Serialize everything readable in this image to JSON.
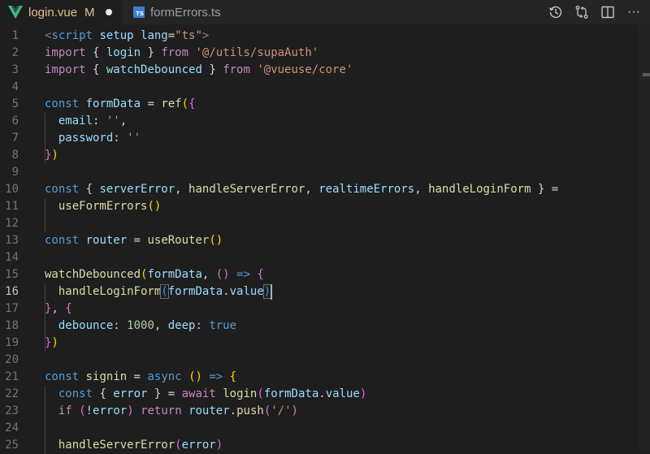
{
  "tabs": [
    {
      "label": "login.vue",
      "modified": "M",
      "icon": "vue-icon",
      "active": true
    },
    {
      "label": "formErrors.ts",
      "icon": "typescript-icon",
      "ts_badge": "TS",
      "active": false
    }
  ],
  "actions": [
    {
      "name": "timeline-icon"
    },
    {
      "name": "source-control-compare-icon"
    },
    {
      "name": "split-editor-icon"
    },
    {
      "name": "more-actions-icon",
      "glyph": "···"
    }
  ],
  "current_line": 16,
  "lines": [
    {
      "n": "1",
      "tokens": [
        [
          "tag",
          "<"
        ],
        [
          "kw",
          "script"
        ],
        [
          "var",
          " setup"
        ],
        [
          "var",
          " lang"
        ],
        [
          "pu",
          "="
        ],
        [
          "str",
          "\"ts\""
        ],
        [
          "tag",
          ">"
        ]
      ]
    },
    {
      "n": "2",
      "tokens": [
        [
          "ctl",
          "import"
        ],
        [
          "pu",
          " { "
        ],
        [
          "var",
          "login"
        ],
        [
          "pu",
          " } "
        ],
        [
          "ctl",
          "from"
        ],
        [
          "pu",
          " "
        ],
        [
          "str",
          "'@/utils/supaAuth'"
        ]
      ]
    },
    {
      "n": "3",
      "tokens": [
        [
          "ctl",
          "import"
        ],
        [
          "pu",
          " { "
        ],
        [
          "var",
          "watchDebounced"
        ],
        [
          "pu",
          " } "
        ],
        [
          "ctl",
          "from"
        ],
        [
          "pu",
          " "
        ],
        [
          "str",
          "'@vueuse/core'"
        ]
      ]
    },
    {
      "n": "4",
      "tokens": []
    },
    {
      "n": "5",
      "tokens": [
        [
          "kw",
          "const"
        ],
        [
          "pu",
          " "
        ],
        [
          "var",
          "formData"
        ],
        [
          "pu",
          " = "
        ],
        [
          "fn",
          "ref"
        ],
        [
          "br1",
          "("
        ],
        [
          "br2",
          "{"
        ]
      ]
    },
    {
      "n": "6",
      "tokens": [
        [
          "pu",
          "  "
        ],
        [
          "var",
          "email"
        ],
        [
          "pu",
          ": "
        ],
        [
          "str",
          "''"
        ],
        [
          "pu",
          ","
        ]
      ]
    },
    {
      "n": "7",
      "tokens": [
        [
          "pu",
          "  "
        ],
        [
          "var",
          "password"
        ],
        [
          "pu",
          ": "
        ],
        [
          "str",
          "''"
        ]
      ]
    },
    {
      "n": "8",
      "tokens": [
        [
          "br2",
          "}"
        ],
        [
          "br1",
          ")"
        ]
      ]
    },
    {
      "n": "9",
      "tokens": []
    },
    {
      "n": "10",
      "tokens": [
        [
          "kw",
          "const"
        ],
        [
          "pu",
          " { "
        ],
        [
          "var",
          "serverError"
        ],
        [
          "pu",
          ", "
        ],
        [
          "fn",
          "handleServerError"
        ],
        [
          "pu",
          ", "
        ],
        [
          "var",
          "realtimeErrors"
        ],
        [
          "pu",
          ", "
        ],
        [
          "fn",
          "handleLoginForm"
        ],
        [
          "pu",
          " } ="
        ]
      ]
    },
    {
      "n": "11",
      "tokens": [
        [
          "pu",
          "  "
        ],
        [
          "fn",
          "useFormErrors"
        ],
        [
          "br1",
          "()"
        ]
      ]
    },
    {
      "n": "12",
      "tokens": []
    },
    {
      "n": "13",
      "tokens": [
        [
          "kw",
          "const"
        ],
        [
          "pu",
          " "
        ],
        [
          "var",
          "router"
        ],
        [
          "pu",
          " = "
        ],
        [
          "fn",
          "useRouter"
        ],
        [
          "br1",
          "()"
        ]
      ]
    },
    {
      "n": "14",
      "tokens": []
    },
    {
      "n": "15",
      "tokens": [
        [
          "fn",
          "watchDebounced"
        ],
        [
          "br1",
          "("
        ],
        [
          "var",
          "formData"
        ],
        [
          "pu",
          ", "
        ],
        [
          "br2",
          "()"
        ],
        [
          "pu",
          " "
        ],
        [
          "kw",
          "=>"
        ],
        [
          "pu",
          " "
        ],
        [
          "br2",
          "{"
        ]
      ]
    },
    {
      "n": "16",
      "tokens": [
        [
          "pu",
          "  "
        ],
        [
          "fn",
          "handleLoginForm"
        ],
        [
          "hl",
          "("
        ],
        [
          "var",
          "formData"
        ],
        [
          "pu",
          "."
        ],
        [
          "var",
          "value"
        ],
        [
          "hl",
          ")"
        ]
      ]
    },
    {
      "n": "17",
      "tokens": [
        [
          "br2",
          "}"
        ],
        [
          "pu",
          ", "
        ],
        [
          "br2",
          "{"
        ]
      ]
    },
    {
      "n": "18",
      "tokens": [
        [
          "pu",
          "  "
        ],
        [
          "var",
          "debounce"
        ],
        [
          "pu",
          ": "
        ],
        [
          "num",
          "1000"
        ],
        [
          "pu",
          ", "
        ],
        [
          "var",
          "deep"
        ],
        [
          "pu",
          ": "
        ],
        [
          "kw",
          "true"
        ]
      ]
    },
    {
      "n": "19",
      "tokens": [
        [
          "br2",
          "}"
        ],
        [
          "br1",
          ")"
        ]
      ]
    },
    {
      "n": "20",
      "tokens": []
    },
    {
      "n": "21",
      "tokens": [
        [
          "kw",
          "const"
        ],
        [
          "pu",
          " "
        ],
        [
          "fn",
          "signin"
        ],
        [
          "pu",
          " = "
        ],
        [
          "kw",
          "async"
        ],
        [
          "pu",
          " "
        ],
        [
          "br1",
          "()"
        ],
        [
          "pu",
          " "
        ],
        [
          "kw",
          "=>"
        ],
        [
          "pu",
          " "
        ],
        [
          "br1",
          "{"
        ]
      ]
    },
    {
      "n": "22",
      "tokens": [
        [
          "pu",
          "  "
        ],
        [
          "kw",
          "const"
        ],
        [
          "pu",
          " { "
        ],
        [
          "var",
          "error"
        ],
        [
          "pu",
          " } = "
        ],
        [
          "ctl",
          "await"
        ],
        [
          "pu",
          " "
        ],
        [
          "fn",
          "login"
        ],
        [
          "br2",
          "("
        ],
        [
          "var",
          "formData"
        ],
        [
          "pu",
          "."
        ],
        [
          "var",
          "value"
        ],
        [
          "br2",
          ")"
        ]
      ]
    },
    {
      "n": "23",
      "tokens": [
        [
          "pu",
          "  "
        ],
        [
          "ctl",
          "if"
        ],
        [
          "pu",
          " "
        ],
        [
          "br2",
          "("
        ],
        [
          "pu",
          "!"
        ],
        [
          "var",
          "error"
        ],
        [
          "br2",
          ")"
        ],
        [
          "pu",
          " "
        ],
        [
          "ctl",
          "return"
        ],
        [
          "pu",
          " "
        ],
        [
          "var",
          "router"
        ],
        [
          "pu",
          "."
        ],
        [
          "fn",
          "push"
        ],
        [
          "br2",
          "("
        ],
        [
          "str",
          "'/'"
        ],
        [
          "br2",
          ")"
        ]
      ]
    },
    {
      "n": "24",
      "tokens": []
    },
    {
      "n": "25",
      "tokens": [
        [
          "pu",
          "  "
        ],
        [
          "fn",
          "handleServerError"
        ],
        [
          "br2",
          "("
        ],
        [
          "var",
          "error"
        ],
        [
          "br2",
          ")"
        ]
      ]
    }
  ],
  "colors": {
    "editor_bg": "#1e1e1e",
    "tabbar_bg": "#252526",
    "modified": "#e2c08d",
    "keyword": "#569cd6",
    "control": "#c586c0",
    "function": "#dcdcaa",
    "variable": "#9cdcfe",
    "string": "#ce9178",
    "number": "#b5cea8"
  }
}
